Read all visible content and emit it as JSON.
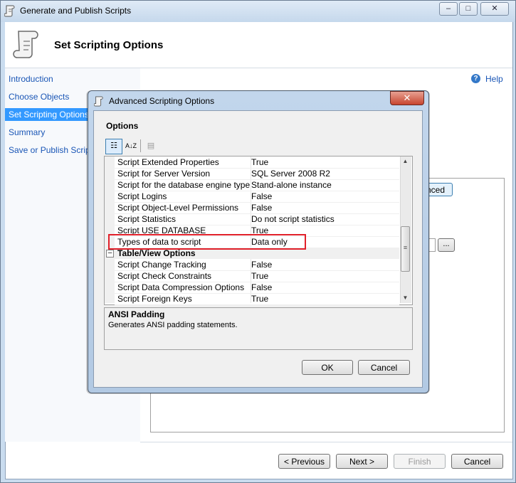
{
  "window": {
    "title": "Generate and Publish Scripts",
    "buttons": {
      "minimize": "–",
      "maximize": "□",
      "close": "✕"
    }
  },
  "header": {
    "title": "Set Scripting Options"
  },
  "nav": {
    "items": [
      {
        "label": "Introduction",
        "active": false
      },
      {
        "label": "Choose Objects",
        "active": false
      },
      {
        "label": "Set Scripting Options",
        "active": true
      },
      {
        "label": "Summary",
        "active": false
      },
      {
        "label": "Save or Publish Scripts",
        "active": false
      }
    ]
  },
  "help": {
    "label": "Help",
    "icon": "?"
  },
  "background": {
    "advanced_label": "nced",
    "browse_label": "..."
  },
  "footer": {
    "previous": "< Previous",
    "next": "Next >",
    "finish": "Finish",
    "cancel": "Cancel"
  },
  "dialog": {
    "title": "Advanced Scripting Options",
    "close": "✕",
    "options_label": "Options",
    "toolbar": {
      "categorized": "☷",
      "alphabetical": "A↓Z",
      "pages": "▤"
    },
    "rows": [
      {
        "name": "Script Extended Properties",
        "value": "True"
      },
      {
        "name": "Script for Server Version",
        "value": "SQL Server 2008 R2"
      },
      {
        "name": "Script for the database engine type",
        "value": "Stand-alone instance"
      },
      {
        "name": "Script Logins",
        "value": "False"
      },
      {
        "name": "Script Object-Level Permissions",
        "value": "False"
      },
      {
        "name": "Script Statistics",
        "value": "Do not script statistics"
      },
      {
        "name": "Script USE DATABASE",
        "value": "True"
      },
      {
        "name": "Types of data to script",
        "value": "Data only"
      }
    ],
    "category": {
      "label": "Table/View Options",
      "toggle": "–"
    },
    "rows2": [
      {
        "name": "Script Change Tracking",
        "value": "False"
      },
      {
        "name": "Script Check Constraints",
        "value": "True"
      },
      {
        "name": "Script Data Compression Options",
        "value": "False"
      },
      {
        "name": "Script Foreign Keys",
        "value": "True"
      }
    ],
    "scrollbar": {
      "up": "▲",
      "down": "▼",
      "grip": "≡"
    },
    "description": {
      "title": "ANSI Padding",
      "text": "Generates ANSI padding statements."
    },
    "ok": "OK",
    "cancel": "Cancel"
  }
}
